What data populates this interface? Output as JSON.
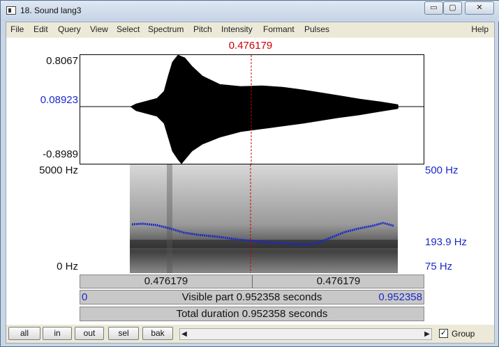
{
  "window": {
    "title": "18. Sound lang3",
    "controls": {
      "minimize": "▭",
      "maximize": "▢",
      "close": "✕"
    }
  },
  "menu": {
    "items": [
      "File",
      "Edit",
      "Query",
      "View",
      "Select",
      "Spectrum",
      "Pitch",
      "Intensity",
      "Formant",
      "Pulses"
    ],
    "help": "Help"
  },
  "editor": {
    "cursor_time": "0.476179",
    "waveform": {
      "max": "0.8067",
      "value": "0.08923",
      "min": "-0.8989"
    },
    "spectrogram": {
      "top": "5000 Hz",
      "bottom": "0 Hz"
    },
    "pitch": {
      "top": "500 Hz",
      "value": "193.9 Hz",
      "bottom": "75 Hz",
      "color": "#1a28c9"
    },
    "selection": {
      "left": "0.476179",
      "right": "0.476179"
    },
    "visible": {
      "start": "0",
      "label": "Visible part 0.952358 seconds",
      "end": "0.952358"
    },
    "total": "Total duration 0.952358 seconds"
  },
  "bottom": {
    "buttons": [
      "all",
      "in",
      "out",
      "sel",
      "bak"
    ],
    "group_label": "Group",
    "group_checked": "✓",
    "scroll_left": "◀",
    "scroll_right": "▶"
  }
}
